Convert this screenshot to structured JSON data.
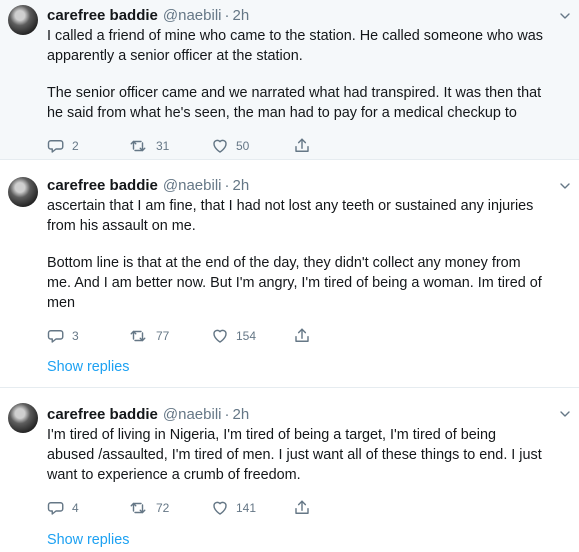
{
  "tweets": [
    {
      "name": "carefree baddie",
      "handle": "@naebili",
      "separator": "·",
      "time": "2h",
      "lines": [
        "I called a friend of mine who came to the station. He called someone who was",
        "apparently a senior officer at the station.",
        "",
        "The senior officer came and we narrated what had transpired. It was then that",
        "he said from what he's seen, the man had to pay for a medical checkup to"
      ],
      "stats": {
        "replies": "2",
        "retweets": "31",
        "likes": "50"
      }
    },
    {
      "name": "carefree baddie",
      "handle": "@naebili",
      "separator": "·",
      "time": "2h",
      "lines": [
        "ascertain that I am fine, that I had not lost any teeth or sustained any injuries",
        "from his assault on me.",
        "",
        "Bottom line is that at the end of the day, they didn't collect any money from",
        "me. And I am better now. But I'm angry, I'm tired of being a woman. Im tired of",
        "men"
      ],
      "stats": {
        "replies": "3",
        "retweets": "77",
        "likes": "154"
      },
      "show_replies": "Show replies"
    },
    {
      "name": "carefree baddie",
      "handle": "@naebili",
      "separator": "·",
      "time": "2h",
      "lines": [
        "I'm tired of living in Nigeria, I'm tired of being a target, I'm tired of being",
        "abused /assaulted, I'm tired of men. I just want all of these things to end. I just",
        "want to experience a crumb of freedom."
      ],
      "stats": {
        "replies": "4",
        "retweets": "72",
        "likes": "141"
      },
      "show_replies": "Show replies"
    }
  ],
  "icons": {
    "reply": "reply-icon",
    "retweet": "retweet-icon",
    "like": "heart-icon",
    "share": "share-icon",
    "menu": "chevron-down-icon"
  },
  "colors": {
    "text": "#14171a",
    "secondary": "#657786",
    "link": "#1da1f2",
    "highlight_background": "#f5f8fa",
    "border": "#e6ecf0"
  }
}
